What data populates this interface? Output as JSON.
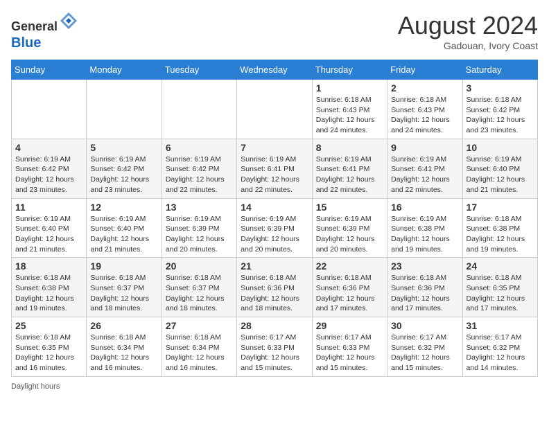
{
  "header": {
    "logo_general": "General",
    "logo_blue": "Blue",
    "month_year": "August 2024",
    "location": "Gadouan, Ivory Coast"
  },
  "days_of_week": [
    "Sunday",
    "Monday",
    "Tuesday",
    "Wednesday",
    "Thursday",
    "Friday",
    "Saturday"
  ],
  "footer": {
    "daylight_hours_label": "Daylight hours"
  },
  "weeks": [
    [
      {
        "day": "",
        "details": ""
      },
      {
        "day": "",
        "details": ""
      },
      {
        "day": "",
        "details": ""
      },
      {
        "day": "",
        "details": ""
      },
      {
        "day": "1",
        "details": "Sunrise: 6:18 AM\nSunset: 6:43 PM\nDaylight: 12 hours and 24 minutes."
      },
      {
        "day": "2",
        "details": "Sunrise: 6:18 AM\nSunset: 6:43 PM\nDaylight: 12 hours and 24 minutes."
      },
      {
        "day": "3",
        "details": "Sunrise: 6:18 AM\nSunset: 6:42 PM\nDaylight: 12 hours and 23 minutes."
      }
    ],
    [
      {
        "day": "4",
        "details": "Sunrise: 6:19 AM\nSunset: 6:42 PM\nDaylight: 12 hours and 23 minutes."
      },
      {
        "day": "5",
        "details": "Sunrise: 6:19 AM\nSunset: 6:42 PM\nDaylight: 12 hours and 23 minutes."
      },
      {
        "day": "6",
        "details": "Sunrise: 6:19 AM\nSunset: 6:42 PM\nDaylight: 12 hours and 22 minutes."
      },
      {
        "day": "7",
        "details": "Sunrise: 6:19 AM\nSunset: 6:41 PM\nDaylight: 12 hours and 22 minutes."
      },
      {
        "day": "8",
        "details": "Sunrise: 6:19 AM\nSunset: 6:41 PM\nDaylight: 12 hours and 22 minutes."
      },
      {
        "day": "9",
        "details": "Sunrise: 6:19 AM\nSunset: 6:41 PM\nDaylight: 12 hours and 22 minutes."
      },
      {
        "day": "10",
        "details": "Sunrise: 6:19 AM\nSunset: 6:40 PM\nDaylight: 12 hours and 21 minutes."
      }
    ],
    [
      {
        "day": "11",
        "details": "Sunrise: 6:19 AM\nSunset: 6:40 PM\nDaylight: 12 hours and 21 minutes."
      },
      {
        "day": "12",
        "details": "Sunrise: 6:19 AM\nSunset: 6:40 PM\nDaylight: 12 hours and 21 minutes."
      },
      {
        "day": "13",
        "details": "Sunrise: 6:19 AM\nSunset: 6:39 PM\nDaylight: 12 hours and 20 minutes."
      },
      {
        "day": "14",
        "details": "Sunrise: 6:19 AM\nSunset: 6:39 PM\nDaylight: 12 hours and 20 minutes."
      },
      {
        "day": "15",
        "details": "Sunrise: 6:19 AM\nSunset: 6:39 PM\nDaylight: 12 hours and 20 minutes."
      },
      {
        "day": "16",
        "details": "Sunrise: 6:19 AM\nSunset: 6:38 PM\nDaylight: 12 hours and 19 minutes."
      },
      {
        "day": "17",
        "details": "Sunrise: 6:18 AM\nSunset: 6:38 PM\nDaylight: 12 hours and 19 minutes."
      }
    ],
    [
      {
        "day": "18",
        "details": "Sunrise: 6:18 AM\nSunset: 6:38 PM\nDaylight: 12 hours and 19 minutes."
      },
      {
        "day": "19",
        "details": "Sunrise: 6:18 AM\nSunset: 6:37 PM\nDaylight: 12 hours and 18 minutes."
      },
      {
        "day": "20",
        "details": "Sunrise: 6:18 AM\nSunset: 6:37 PM\nDaylight: 12 hours and 18 minutes."
      },
      {
        "day": "21",
        "details": "Sunrise: 6:18 AM\nSunset: 6:36 PM\nDaylight: 12 hours and 18 minutes."
      },
      {
        "day": "22",
        "details": "Sunrise: 6:18 AM\nSunset: 6:36 PM\nDaylight: 12 hours and 17 minutes."
      },
      {
        "day": "23",
        "details": "Sunrise: 6:18 AM\nSunset: 6:36 PM\nDaylight: 12 hours and 17 minutes."
      },
      {
        "day": "24",
        "details": "Sunrise: 6:18 AM\nSunset: 6:35 PM\nDaylight: 12 hours and 17 minutes."
      }
    ],
    [
      {
        "day": "25",
        "details": "Sunrise: 6:18 AM\nSunset: 6:35 PM\nDaylight: 12 hours and 16 minutes."
      },
      {
        "day": "26",
        "details": "Sunrise: 6:18 AM\nSunset: 6:34 PM\nDaylight: 12 hours and 16 minutes."
      },
      {
        "day": "27",
        "details": "Sunrise: 6:18 AM\nSunset: 6:34 PM\nDaylight: 12 hours and 16 minutes."
      },
      {
        "day": "28",
        "details": "Sunrise: 6:17 AM\nSunset: 6:33 PM\nDaylight: 12 hours and 15 minutes."
      },
      {
        "day": "29",
        "details": "Sunrise: 6:17 AM\nSunset: 6:33 PM\nDaylight: 12 hours and 15 minutes."
      },
      {
        "day": "30",
        "details": "Sunrise: 6:17 AM\nSunset: 6:32 PM\nDaylight: 12 hours and 15 minutes."
      },
      {
        "day": "31",
        "details": "Sunrise: 6:17 AM\nSunset: 6:32 PM\nDaylight: 12 hours and 14 minutes."
      }
    ]
  ]
}
